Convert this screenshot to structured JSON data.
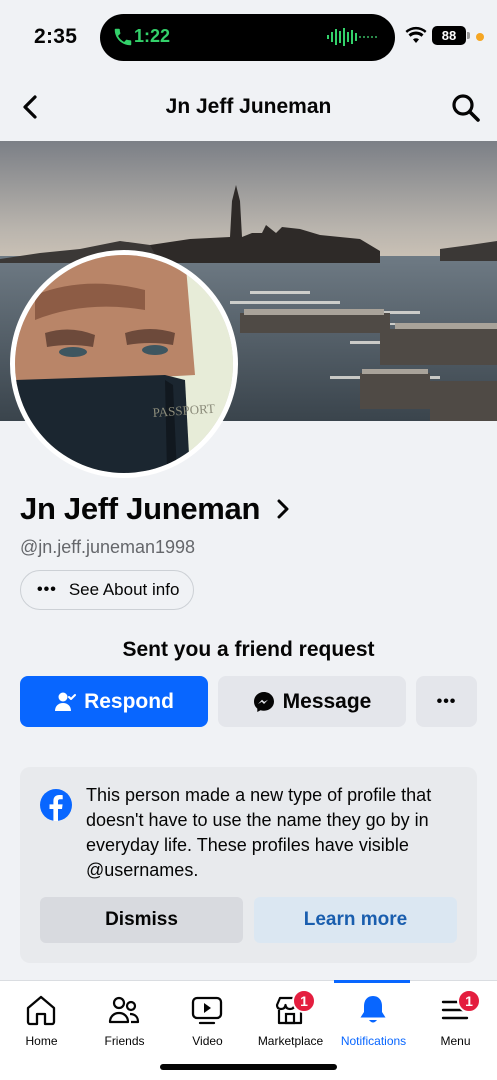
{
  "status": {
    "time": "2:35",
    "call_time": "1:22",
    "battery": "88"
  },
  "header": {
    "title": "Jn Jeff Juneman",
    "back_icon": "chevron-left-icon",
    "search_icon": "search-icon"
  },
  "profile": {
    "name": "Jn Jeff Juneman",
    "username": "@jn.jeff.juneman1998",
    "about_label": "See About info",
    "passport_text": "PASSPORT"
  },
  "friend_request": {
    "text": "Sent you a friend request",
    "respond_label": "Respond",
    "message_label": "Message"
  },
  "notice": {
    "text": "This person made a new type of profile that doesn't have to use the name they go by in everyday life. These profiles have visible @usernames.",
    "dismiss_label": "Dismiss",
    "learn_more_label": "Learn more"
  },
  "tabs": [
    {
      "label": "Home",
      "icon": "home-icon"
    },
    {
      "label": "Friends",
      "icon": "friends-icon"
    },
    {
      "label": "Video",
      "icon": "video-icon"
    },
    {
      "label": "Marketplace",
      "icon": "marketplace-icon",
      "badge": "1"
    },
    {
      "label": "Notifications",
      "icon": "bell-icon",
      "active": true
    },
    {
      "label": "Menu",
      "icon": "menu-icon",
      "badge": "1"
    }
  ],
  "colors": {
    "accent": "#0866ff",
    "badge": "#e41e3f",
    "call_green": "#33d16a"
  }
}
